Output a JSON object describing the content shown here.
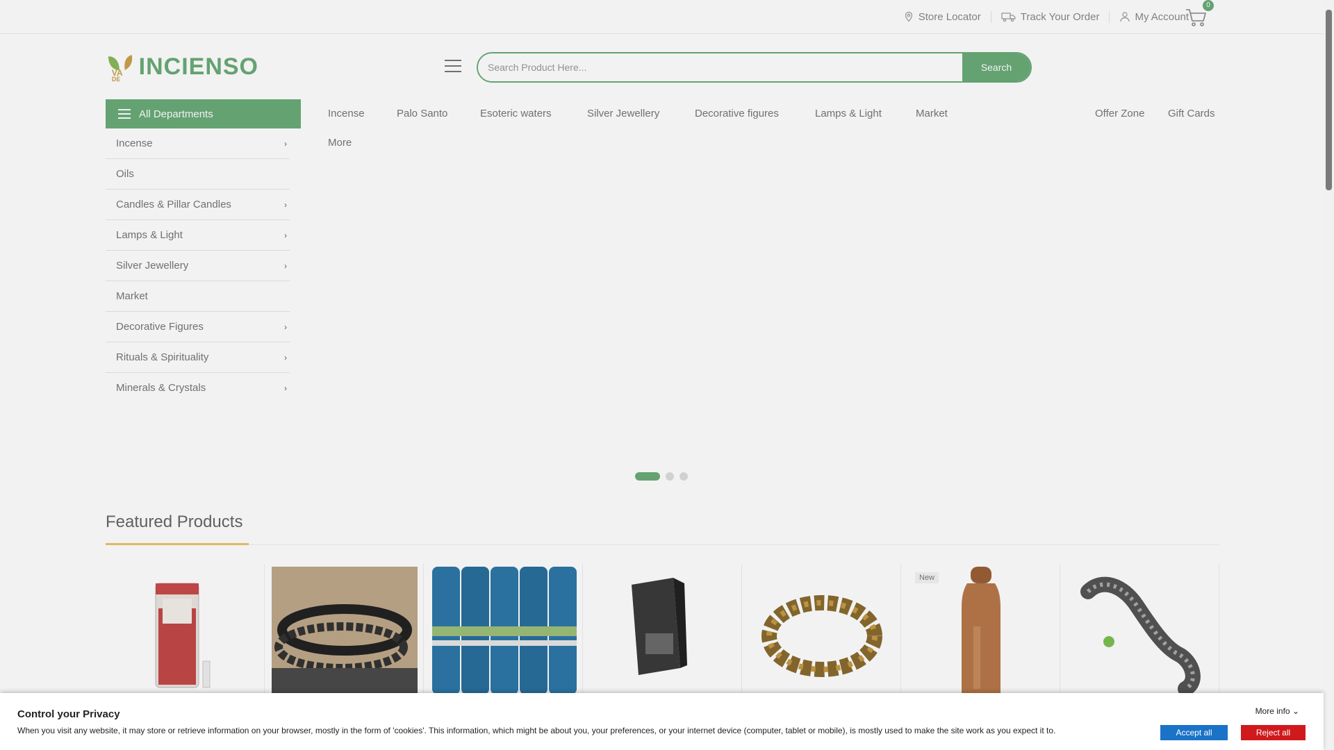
{
  "colors": {
    "accent": "#6aab79",
    "accept": "#1a73c7",
    "reject": "#d0191c",
    "underline": "#e9c46a"
  },
  "topbar": {
    "store_locator": "Store Locator",
    "track_order": "Track Your Order",
    "my_account": "My Account",
    "cart_count": "0"
  },
  "logo": {
    "prefix_top": "VA",
    "prefix_bottom": "DE",
    "name": "INCIENSO"
  },
  "search": {
    "placeholder": "Search Product Here...",
    "button": "Search"
  },
  "departments": {
    "label": "All Departments",
    "items": [
      {
        "label": "Incense",
        "has_sub": true
      },
      {
        "label": "Oils",
        "has_sub": false
      },
      {
        "label": "Candles & Pillar Candles",
        "has_sub": true
      },
      {
        "label": "Lamps & Light",
        "has_sub": true
      },
      {
        "label": "Silver Jewellery",
        "has_sub": true
      },
      {
        "label": "Market",
        "has_sub": false
      },
      {
        "label": "Decorative Figures",
        "has_sub": true
      },
      {
        "label": "Rituals & Spirituality",
        "has_sub": true
      },
      {
        "label": "Minerals & Crystals",
        "has_sub": true
      }
    ]
  },
  "nav": {
    "items": [
      "Incense",
      "Palo Santo",
      "Esoteric waters",
      "Silver Jewellery",
      "Decorative figures",
      "Lamps & Light",
      "Market",
      "More"
    ],
    "offer_zone": "Offer Zone",
    "gift_cards": "Gift Cards"
  },
  "slider": {
    "active_slide": 1,
    "total_slides": 3
  },
  "featured": {
    "title": "Featured Products",
    "products": [
      {
        "icon": "candle-jar-product",
        "badge": ""
      },
      {
        "icon": "bead-bracelet-product",
        "badge": ""
      },
      {
        "icon": "incense-tubes-product",
        "badge": ""
      },
      {
        "icon": "incense-box-product",
        "badge": ""
      },
      {
        "icon": "tiger-eye-bracelet-product",
        "badge": ""
      },
      {
        "icon": "copper-bottle-product",
        "badge": "New"
      },
      {
        "icon": "lizard-figure-product",
        "badge": ""
      }
    ]
  },
  "cookie": {
    "title": "Control your Privacy",
    "text": "When you visit any website, it may store or retrieve information on your browser, mostly in the form of 'cookies'. This information, which might be about you, your preferences, or your internet device (computer, tablet or mobile), is mostly used to make the site work as you expect it to.",
    "more_info": "More info",
    "accept": "Accept all",
    "reject": "Reject all"
  }
}
